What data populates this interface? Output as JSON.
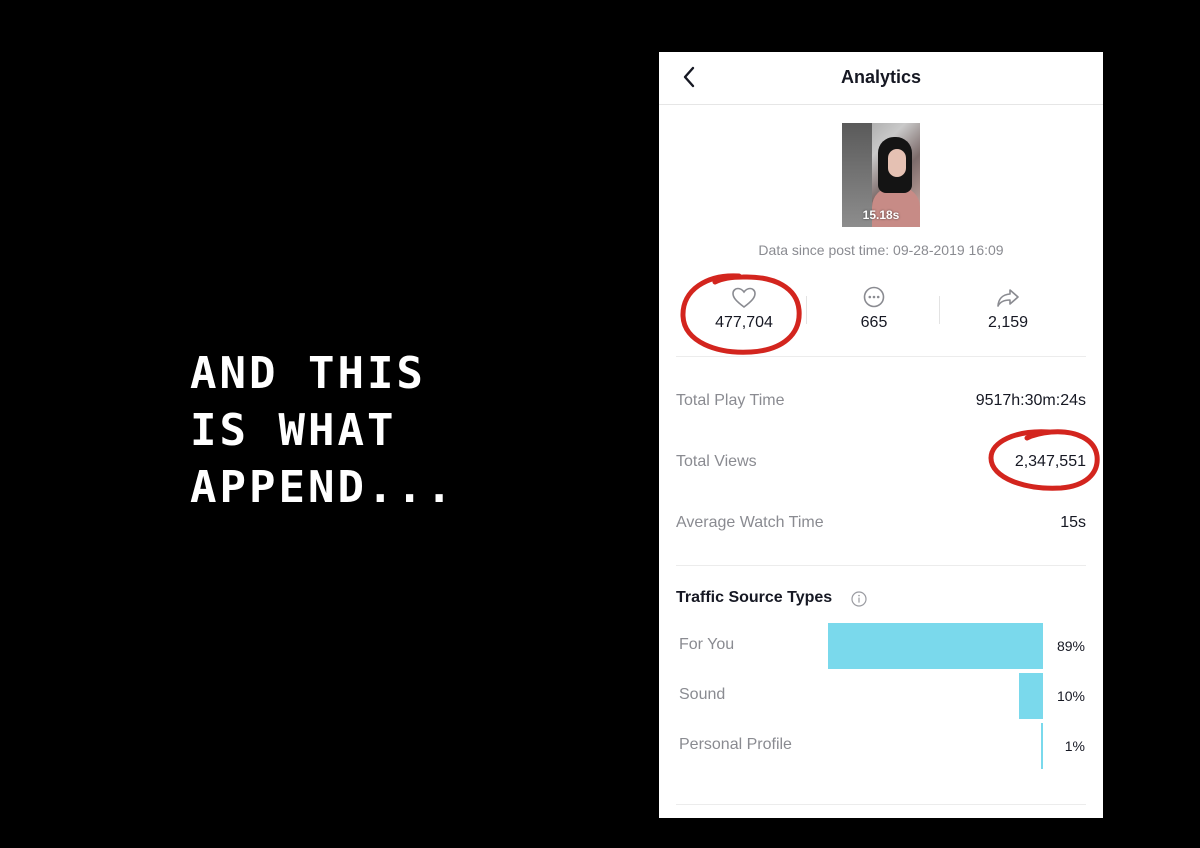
{
  "caption": {
    "lines": [
      "AND THIS",
      "IS WHAT",
      "APPEND..."
    ]
  },
  "header": {
    "title": "Analytics",
    "back_icon": "chevron-left-icon"
  },
  "video": {
    "duration": "15.18s",
    "since": "Data since post time: 09-28-2019 16:09"
  },
  "stats": [
    {
      "icon": "heart-icon",
      "value": "477,704"
    },
    {
      "icon": "comment-icon",
      "value": "665"
    },
    {
      "icon": "share-icon",
      "value": "2,159"
    }
  ],
  "metrics": [
    {
      "label": "Total Play Time",
      "value": "9517h:30m:24s"
    },
    {
      "label": "Total Views",
      "value": "2,347,551"
    },
    {
      "label": "Average Watch Time",
      "value": "15s"
    }
  ],
  "traffic": {
    "title": "Traffic Source Types",
    "info_icon": "info-icon",
    "bar_color": "#7ad9ec",
    "sources": [
      {
        "label": "For You",
        "percent_label": "89%",
        "percent": 89
      },
      {
        "label": "Sound",
        "percent_label": "10%",
        "percent": 10
      },
      {
        "label": "Personal Profile",
        "percent_label": "1%",
        "percent": 1
      }
    ]
  },
  "annotation_color": "#d3251e"
}
